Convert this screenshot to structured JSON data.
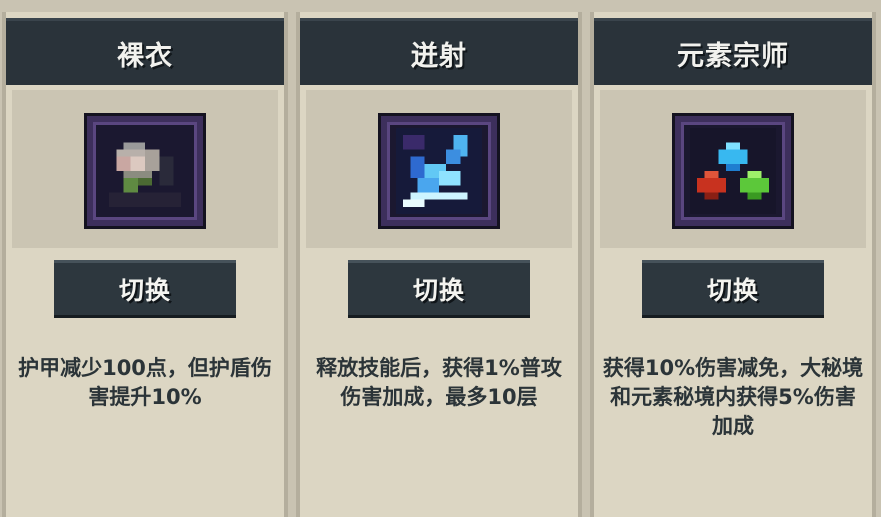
{
  "cards": [
    {
      "title": "裸衣",
      "icon": "naked-armor-icon",
      "button_label": "切换",
      "description": "护甲减少100点，但护盾伤害提升10%"
    },
    {
      "title": "迸射",
      "icon": "burst-skill-icon",
      "button_label": "切换",
      "description": "释放技能后，获得1%普攻伤害加成，最多10层"
    },
    {
      "title": "元素宗师",
      "icon": "element-master-icon",
      "button_label": "切换",
      "description": "获得10%伤害减免，大秘境和元素秘境内获得5%伤害加成"
    }
  ],
  "colors": {
    "background": "#c9c3b2",
    "header": "#2a333a",
    "button": "#2d373e",
    "icon_frame": "#3d2f5c",
    "text": "#2b3438"
  }
}
